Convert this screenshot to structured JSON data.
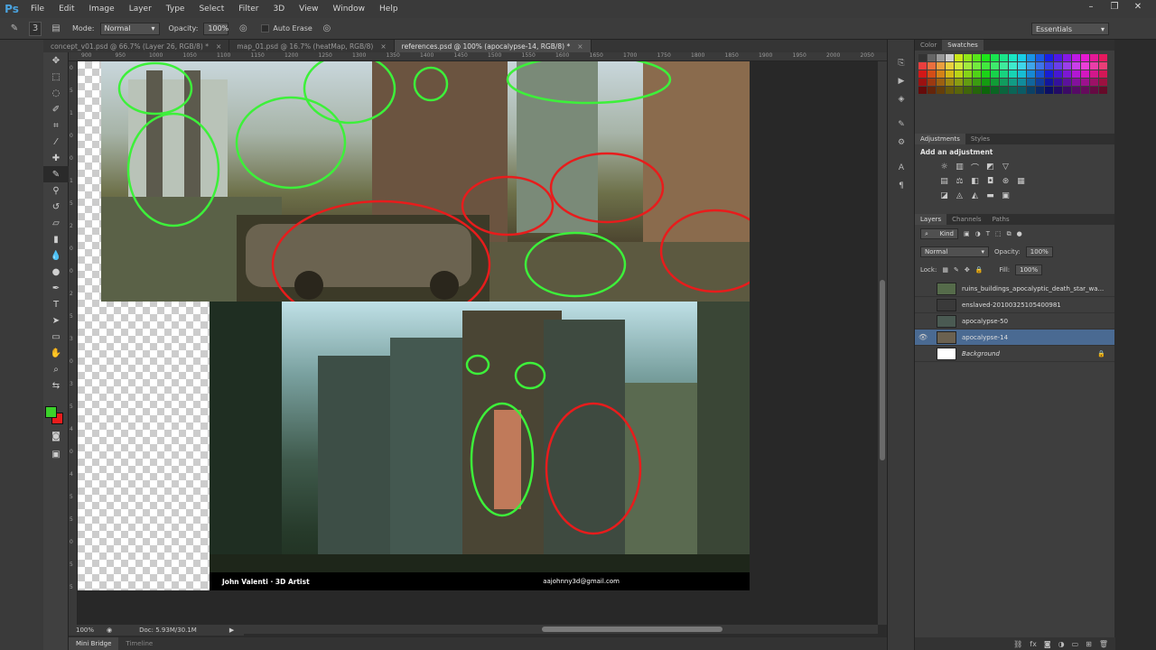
{
  "app": {
    "logo": "Ps"
  },
  "menu": [
    "File",
    "Edit",
    "Image",
    "Layer",
    "Type",
    "Select",
    "Filter",
    "3D",
    "View",
    "Window",
    "Help"
  ],
  "window_controls": [
    "–",
    "❐",
    "✕"
  ],
  "options": {
    "mode_label": "Mode:",
    "mode_value": "Normal",
    "opacity_label": "Opacity:",
    "opacity_value": "100%",
    "auto_erase": "Auto Erase",
    "workspace": "Essentials",
    "brush_size": "3"
  },
  "tabs": [
    {
      "label": "concept_v01.psd @ 66.7% (Layer 26, RGB/8) *",
      "active": false
    },
    {
      "label": "map_01.psd @ 16.7% (heatMap, RGB/8)",
      "active": false
    },
    {
      "label": "references.psd @ 100% (apocalypse-14, RGB/8) *",
      "active": true
    }
  ],
  "ruler_top": [
    "900",
    "950",
    "1000",
    "1050",
    "1100",
    "1150",
    "1200",
    "1250",
    "1300",
    "1350",
    "1400",
    "1450",
    "1500",
    "1550",
    "1600",
    "1650",
    "1700",
    "1750",
    "1800",
    "1850",
    "1900",
    "1950",
    "2000",
    "2050"
  ],
  "ruler_left": [
    "0",
    "5",
    "1",
    "0",
    "0",
    "1",
    "5",
    "2",
    "0",
    "0",
    "2",
    "5",
    "3",
    "0",
    "3",
    "5",
    "4",
    "0",
    "4",
    "5",
    "5",
    "0",
    "5",
    "5"
  ],
  "canvas": {
    "caption_left": "John Valenti · 3D Artist",
    "caption_right": "aajohnny3d@gmail.com"
  },
  "status": {
    "zoom": "100%",
    "doc": "Doc: 5.93M/30.1M"
  },
  "bottom_tabs": [
    "Mini Bridge",
    "Timeline"
  ],
  "panels": {
    "color_tabs": [
      "Color",
      "Swatches"
    ],
    "adjustments_tabs": [
      "Adjustments",
      "Styles"
    ],
    "add_adjustment": "Add an adjustment",
    "layers_tabs": [
      "Layers",
      "Channels",
      "Paths"
    ],
    "kind_label": "Kind",
    "blend_mode": "Normal",
    "opacity_label": "Opacity:",
    "opacity_value": "100%",
    "lock_label": "Lock:",
    "fill_label": "Fill:",
    "fill_value": "100%"
  },
  "layers": [
    {
      "name": "ruins_buildings_apocalyptic_death_star_wa...",
      "visible": false,
      "active": false
    },
    {
      "name": "enslaved-20100325105400981",
      "visible": false,
      "active": false
    },
    {
      "name": "apocalypse-50",
      "visible": false,
      "active": false
    },
    {
      "name": "apocalypse-14",
      "visible": true,
      "active": true
    },
    {
      "name": "Background",
      "visible": false,
      "active": false,
      "locked": true
    }
  ],
  "colors": {
    "foreground": "#3bd12a",
    "background": "#e81c1c",
    "annotation_green": "#3df03a",
    "annotation_red": "#e81c1c"
  }
}
